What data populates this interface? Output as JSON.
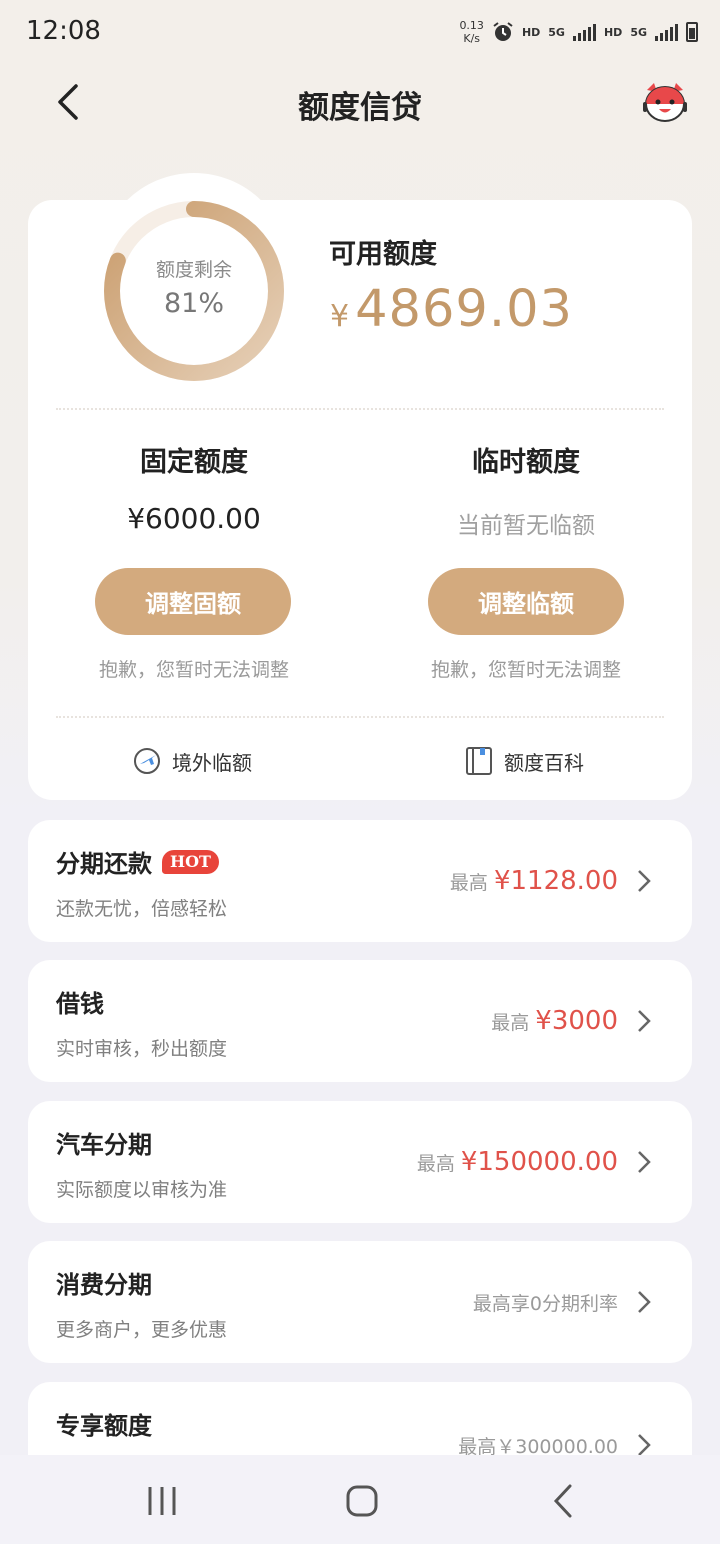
{
  "status_bar": {
    "time": "12:08",
    "net_speed_value": "0.13",
    "net_speed_unit": "K/s",
    "hd1": "HD",
    "net1": "5G",
    "hd2": "HD",
    "net2": "5G"
  },
  "header": {
    "title": "额度信贷"
  },
  "credit": {
    "ring_label": "额度剩余",
    "ring_value": "81%",
    "ring_fraction": 0.81,
    "available_label": "可用额度",
    "available_currency": "¥",
    "available_amount": "4869.03",
    "fixed": {
      "title": "固定额度",
      "amount": "¥6000.00",
      "button": "调整固额",
      "note": "抱歉，您暂时无法调整"
    },
    "temp": {
      "title": "临时额度",
      "status": "当前暂无临额",
      "button": "调整临额",
      "note": "抱歉，您暂时无法调整"
    },
    "links": [
      {
        "label": "境外临额",
        "icon": "plane-globe-icon"
      },
      {
        "label": "额度百科",
        "icon": "book-icon"
      }
    ]
  },
  "products": [
    {
      "title": "分期还款",
      "badge": "HOT",
      "subtitle": "还款无忧，倍感轻松",
      "prefix": "最高",
      "amount": "¥1128.00"
    },
    {
      "title": "借钱",
      "subtitle": "实时审核，秒出额度",
      "prefix": "最高",
      "amount": "¥3000"
    },
    {
      "title": "汽车分期",
      "subtitle": "实际额度以审核为准",
      "prefix": "最高",
      "amount": "¥150000.00"
    },
    {
      "title": "消费分期",
      "subtitle": "更多商户，更多优惠",
      "text": "最高享0分期利率"
    },
    {
      "title": "专享额度",
      "text": "最高￥300000.00"
    }
  ],
  "colors": {
    "accent": "#d3aa7e",
    "amount_gold": "#c3996a",
    "price_red": "#e0524a",
    "hot_red": "#e8443a"
  }
}
